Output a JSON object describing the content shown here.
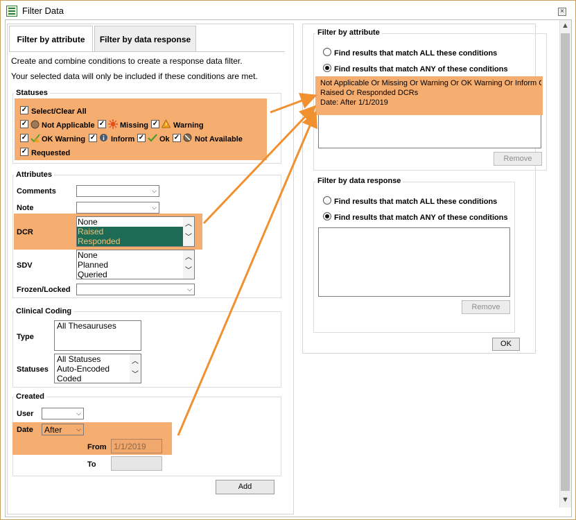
{
  "window": {
    "title": "Filter Data",
    "close_glyph": "×"
  },
  "tabs": [
    {
      "label": "Filter by attribute",
      "active": true
    },
    {
      "label": "Filter by data response",
      "active": false
    }
  ],
  "intro": {
    "line1": "Create and combine conditions to create a response data filter.",
    "line2": "Your selected data will only be included if these conditions are met."
  },
  "statuses": {
    "legend": "Statuses",
    "select_all": "Select/Clear All",
    "items": [
      {
        "label": "Not Applicable",
        "icon": "not-applicable-icon"
      },
      {
        "label": "Missing",
        "icon": "missing-icon"
      },
      {
        "label": "Warning",
        "icon": "warning-icon"
      },
      {
        "label": "OK Warning",
        "icon": "ok-warning-icon"
      },
      {
        "label": "Inform",
        "icon": "inform-icon"
      },
      {
        "label": "Ok",
        "icon": "ok-icon"
      },
      {
        "label": "Not Available",
        "icon": "not-available-icon"
      },
      {
        "label": "Requested",
        "icon": ""
      }
    ]
  },
  "attributes": {
    "legend": "Attributes",
    "comments_label": "Comments",
    "note_label": "Note",
    "dcr_label": "DCR",
    "dcr_options": [
      "None",
      "Raised",
      "Responded"
    ],
    "sdv_label": "SDV",
    "sdv_options": [
      "None",
      "Planned",
      "Queried"
    ],
    "frozen_label": "Frozen/Locked"
  },
  "coding": {
    "legend": "Clinical Coding",
    "type_label": "Type",
    "type_options": [
      "All Thesauruses"
    ],
    "statuses_label": "Statuses",
    "status_options": [
      "All Statuses",
      "Auto-Encoded",
      "Coded"
    ]
  },
  "created": {
    "legend": "Created",
    "user_label": "User",
    "date_label": "Date",
    "date_mode": "After",
    "from_label": "From",
    "from_value": "1/1/2019",
    "to_label": "To"
  },
  "add_button": "Add",
  "right": {
    "attr_group": {
      "legend": "Filter by attribute",
      "all_label": "Find results that match ALL these conditions",
      "any_label": "Find results that match ANY of these conditions",
      "conditions": [
        "Not Applicable Or Missing Or Warning Or OK Warning Or Inform Or",
        "Raised Or Responded DCRs",
        "Date: After 1/1/2019"
      ],
      "remove": "Remove"
    },
    "resp_group": {
      "legend": "Filter by data response",
      "all_label": "Find results that match ALL these conditions",
      "any_label": "Find results that match ANY of these conditions",
      "remove": "Remove"
    },
    "ok": "OK"
  },
  "colors": {
    "highlight": "#f5ad70",
    "arrow": "#f0902e",
    "selected_bg": "#1e6b55"
  }
}
